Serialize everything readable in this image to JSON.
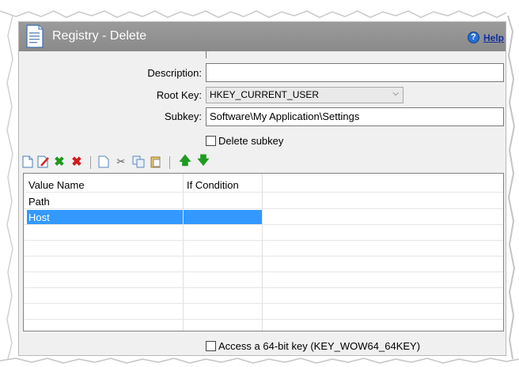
{
  "header": {
    "title": "Registry - Delete",
    "help_label": "Help"
  },
  "form": {
    "description_label": "Description:",
    "description_value": "",
    "root_key_label": "Root Key:",
    "root_key_value": "HKEY_CURRENT_USER",
    "subkey_label": "Subkey:",
    "subkey_value": "Software\\My Application\\Settings",
    "delete_subkey_label": "Delete subkey",
    "delete_subkey_checked": false,
    "access64_label": "Access a 64-bit key (KEY_WOW64_64KEY)",
    "access64_checked": false
  },
  "toolbar": {
    "buttons": [
      "new-icon",
      "edit-icon",
      "check-icon",
      "delete-icon",
      "copy-icon",
      "cut-icon",
      "duplicate-icon",
      "paste-icon",
      "move-up-icon",
      "move-down-icon"
    ]
  },
  "grid": {
    "columns": [
      "Value Name",
      "If Condition"
    ],
    "rows": [
      {
        "name": "Path",
        "condition": "",
        "selected": false
      },
      {
        "name": "Host",
        "condition": "",
        "selected": true
      }
    ]
  },
  "colors": {
    "header_bg": "#8f8f8f",
    "selection": "#3399ff",
    "panel_bg": "#f0f0f0"
  }
}
